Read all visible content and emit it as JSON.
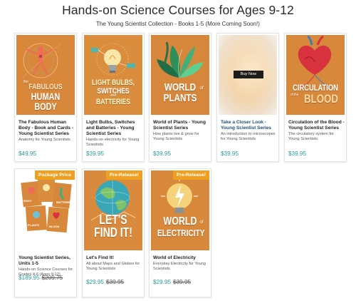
{
  "header": {
    "title": "Hands-on Science Courses for Ages 9-12",
    "subtitle": "The Young Scientist Collection - Books 1-5 (More Coming Soon!)"
  },
  "colors": {
    "price": "#2f9a9a",
    "ribbon": "#f0a020",
    "cover_orange": "#d98a3c"
  },
  "products": [
    {
      "title": "The Fabulous Human Body - Book and Cards - Young Scientist Series",
      "description": "Anatomy for Young Scientists",
      "price": "$49.95",
      "cover_lines": [
        "FABULOUS",
        "HUMAN",
        "BODY"
      ],
      "cover_prefix": "the",
      "cover_icon": "vitruvian-figure-icon"
    },
    {
      "title": "Light Bulbs, Switches and Batteries - Young Scientist Series",
      "description": "Hands-on electricity for Young Scientists",
      "price": "$39.95",
      "cover_lines": [
        "LIGHT BULBS,",
        "SWITCHES",
        "BATTERIES"
      ],
      "cover_and": "and",
      "cover_icon": "light-bulb-icon"
    },
    {
      "title": "World of Plants - Young Scientist Series",
      "description": "How plants live & grow for Young Scientists",
      "price": "$39.95",
      "cover_lines": [
        "WORLD",
        "PLANTS"
      ],
      "cover_of": "of",
      "cover_icon": "leaves-icon"
    },
    {
      "title": "Take a Closer Look - Young Scientist Series",
      "description": "An introduction to microscopes for Young Scientists",
      "price": "$39.95",
      "button": "Buy Now"
    },
    {
      "title": "Circulation of the Blood - Young Scientist Series",
      "description": "The circulatory system for Young Scientists",
      "price": "$39.95",
      "cover_lines": [
        "CIRCULATION",
        "BLOOD"
      ],
      "cover_of": "of the",
      "cover_icon": "heart-icon"
    },
    {
      "title": "Young Scientist Series, Units 1-5",
      "description": "Hands-on Science Courses for Grades 4-6 (Ages 9-12)",
      "price": "$189.95",
      "old_price": "$209.75",
      "ribbon": "Package Price",
      "cover_icon": "book-stack-icon"
    },
    {
      "title": "Let's Find It!",
      "description": "All about Maps and Globes for Young Scientists",
      "price": "$29.95",
      "old_price": "$39.95",
      "ribbon": "Pre-Release!",
      "cover_lines": [
        "LET'S",
        "FIND IT!"
      ],
      "cover_icon": "globe-icon"
    },
    {
      "title": "World of Electricity",
      "description": "Everyday Electricity for Young Scientists",
      "price": "$29.95",
      "old_price": "$39.95",
      "ribbon": "Pre-Release!",
      "cover_lines": [
        "WORLD",
        "ELECTRICITY"
      ],
      "cover_of": "of",
      "cover_icon": "lightning-bulb-icon"
    }
  ]
}
